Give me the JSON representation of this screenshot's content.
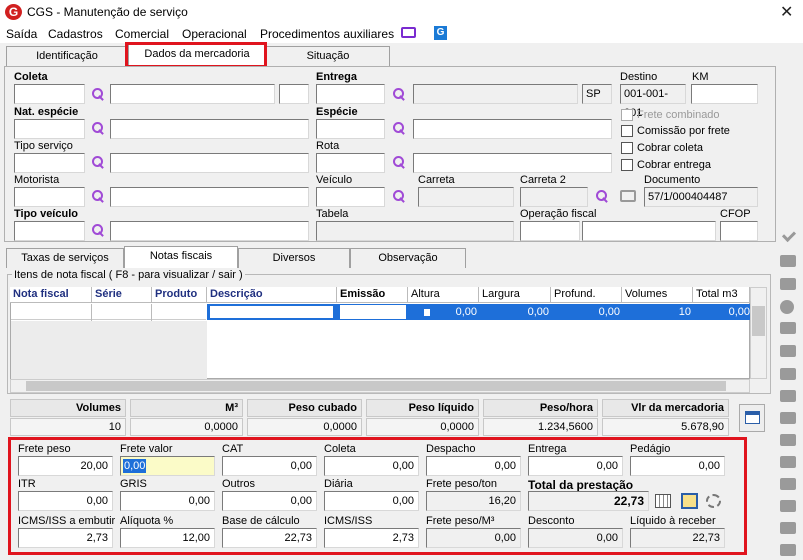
{
  "window": {
    "title": "CGS - Manutenção de serviço",
    "close": "✕"
  },
  "menu": [
    "Saída",
    "Cadastros",
    "Comercial",
    "Operacional",
    "Procedimentos auxiliares"
  ],
  "tabs": {
    "identificacao": "Identificação",
    "dados": "Dados da mercadoria",
    "situacao": "Situação"
  },
  "form": {
    "coleta": "Coleta",
    "entrega": "Entrega",
    "destino": "Destino",
    "km": "KM",
    "uf": "SP",
    "destino_val": "001-001-001",
    "nat_especie": "Nat. espécie",
    "especie": "Espécie",
    "frete_combinado": "Frete combinado",
    "comissao": "Comissão por frete",
    "tipo_servico": "Tipo serviço",
    "rota": "Rota",
    "cobrar_coleta": "Cobrar coleta",
    "cobrar_entrega": "Cobrar entrega",
    "motorista": "Motorista",
    "veiculo": "Veículo",
    "carreta": "Carreta",
    "carreta2": "Carreta 2",
    "documento": "Documento",
    "documento_val": "57/1/000404487",
    "tipo_veiculo": "Tipo veículo",
    "tabela": "Tabela",
    "operacao_fiscal": "Operação fiscal",
    "cfop": "CFOP"
  },
  "subtabs": {
    "taxas": "Taxas de serviços",
    "notas": "Notas fiscais",
    "diversos": "Diversos",
    "observacao": "Observação"
  },
  "group_title": "Itens de nota fiscal ( F8 - para visualizar / sair )",
  "grid": {
    "headers": [
      "Nota fiscal",
      "Série",
      "Produto",
      "Descrição",
      "Emissão",
      "Altura",
      "Largura",
      "Profund.",
      "Volumes",
      "Total m3"
    ],
    "row": [
      "0,00",
      "0,00",
      "0,00",
      "10",
      "0,00"
    ]
  },
  "summary": {
    "headers": [
      "Volumes",
      "M³",
      "Peso cubado",
      "Peso líquido",
      "Peso/hora",
      "Vlr da mercadoria"
    ],
    "values": [
      "10",
      "0,0000",
      "0,0000",
      "0,0000",
      "1.234,5600",
      "5.678,90"
    ]
  },
  "frete": {
    "r1": [
      {
        "l": "Frete peso",
        "v": "20,00"
      },
      {
        "l": "Frete valor",
        "v": "0,00"
      },
      {
        "l": "CAT",
        "v": "0,00"
      },
      {
        "l": "Coleta",
        "v": "0,00"
      },
      {
        "l": "Despacho",
        "v": "0,00"
      },
      {
        "l": "Entrega",
        "v": "0,00"
      },
      {
        "l": "Pedágio",
        "v": "0,00"
      }
    ],
    "r2": [
      {
        "l": "ITR",
        "v": "0,00"
      },
      {
        "l": "GRIS",
        "v": "0,00"
      },
      {
        "l": "Outros",
        "v": "0,00"
      },
      {
        "l": "Diária",
        "v": "0,00"
      },
      {
        "l": "Frete peso/ton",
        "v": "16,20"
      }
    ],
    "total_label": "Total da prestação",
    "total_val": "22,73",
    "r3": [
      {
        "l": "ICMS/ISS a embutir",
        "v": "2,73"
      },
      {
        "l": "Alíquota %",
        "v": "12,00"
      },
      {
        "l": "Base de cálculo",
        "v": "22,73"
      },
      {
        "l": "ICMS/ISS",
        "v": "2,73"
      },
      {
        "l": "Frete peso/M³",
        "v": "0,00"
      },
      {
        "l": "Desconto",
        "v": "0,00"
      },
      {
        "l": "Líquido à receber",
        "v": "22,73"
      }
    ]
  }
}
